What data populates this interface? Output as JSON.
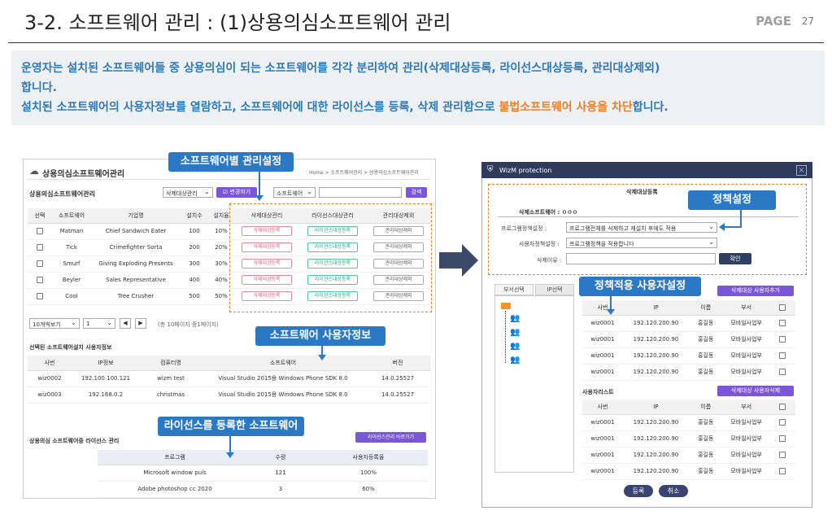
{
  "header": {
    "title": "3-2. 소프트웨어 관리 : (1)상용의심소프트웨어 관리",
    "page_label": "PAGE",
    "page_number": "27"
  },
  "description": {
    "line1": "운영자는 설치된 소프트웨어들 중 상용의심이 되는 소프트웨어를 각각 분리하여 관리(삭제대상등록, 라이선스대상등록, 관리대상제외)",
    "line2": "합니다.",
    "line3_a": "설치된 소프트웨어의 사용자정보를 열람하고, 소프트웨어에 대한 라이선스를 등록, 삭제 관리함으로 ",
    "line3_hl": "불법소프트웨어 사용을 차단",
    "line3_b": "합니다."
  },
  "left_panel": {
    "title": "상용의심소프트웨어관리",
    "breadcrumb": "Home > 소프트웨어관리 > 상용의심소프트웨어관리",
    "list_title": "상용의심소프트웨어관리",
    "filter_select": "삭제대상관리",
    "change_button": "☑ 변경하기",
    "search_select": "소프트웨어",
    "search_button": "검색",
    "columns": [
      "선택",
      "소프트웨어",
      "기업명",
      "설치수",
      "설치율",
      "삭제대상관리",
      "라이선스대상관리",
      "관리대상제외"
    ],
    "rows": [
      {
        "sw": "Matman",
        "company": "Chief Sandwich Eater",
        "count": "100",
        "rate": "10%"
      },
      {
        "sw": "Tick",
        "company": "Crimefighter Sorta",
        "count": "200",
        "rate": "20%"
      },
      {
        "sw": "Smurf",
        "company": "Giving Exploding Presents",
        "count": "300",
        "rate": "30%"
      },
      {
        "sw": "Beyler",
        "company": "Sales Representative",
        "count": "400",
        "rate": "40%"
      },
      {
        "sw": "Cool",
        "company": "Tree Crusher",
        "count": "500",
        "rate": "50%"
      }
    ],
    "tag_delete": "삭제대상등록",
    "tag_license": "라이선스대상등록",
    "tag_exclude": "관리대상제외",
    "page_size": "10개씩보기",
    "page_select": "1",
    "page_info": "(총 10페이지 중1페이지)",
    "user_info_title": "선택된 소프트웨어설치 사용자정보",
    "user_columns": [
      "사번",
      "IP정보",
      "컴퓨터명",
      "소프트웨어",
      "버전"
    ],
    "user_rows": [
      {
        "id": "wiz0002",
        "ip": "192.100.100.121",
        "pc": "wizm test",
        "sw": "Visual Studio 2015용 Windows Phone SDK 8.0",
        "ver": "14.0.25527"
      },
      {
        "id": "wiz0003",
        "ip": "192.168.0.2",
        "pc": "christmas",
        "sw": "Visual Studio 2015용 Windows Phone SDK 8.0",
        "ver": "14.0.25527"
      }
    ],
    "license_title": "상용의심 소프트웨어중 라이선스 관리",
    "license_button": "라이선스관리 바로가기",
    "license_columns": [
      "프로그램",
      "수량",
      "사용자등록율"
    ],
    "license_rows": [
      {
        "program": "Microsoft window puls",
        "qty": "121",
        "rate": "100%"
      },
      {
        "program": "Adobe photoshop cc 2020",
        "qty": "3",
        "rate": "60%"
      }
    ]
  },
  "callouts": {
    "sw_settings": "소프트웨어별 관리설정",
    "sw_user_info": "소프트웨어 사용자정보",
    "license_sw": "라이선스를 등록한 소프트웨어",
    "policy": "정책설정",
    "policy_users": "정책적용 사용자설정"
  },
  "modal": {
    "title": "WizM protection",
    "close": "×",
    "section_title": "삭제대상등록",
    "target_sw": "삭제소프트웨어 : ㅇㅇㅇ",
    "label_program_policy": "프로그램정책설정 :",
    "program_policy_value": "프로그램전체를 삭제하고 재설치 후에도 적용",
    "label_user_policy": "사용자정책설정 :",
    "user_policy_value": "프로그램정책을 적용합니다",
    "label_reason": "삭제이유 :",
    "confirm_button": "확인",
    "tab_dept": "부서선택",
    "tab_ip": "IP선택",
    "add_user_button": "삭제대상 사용자추가",
    "user_columns": [
      "사번",
      "IP",
      "이름",
      "부서"
    ],
    "target_rows": [
      {
        "id": "wiz0001",
        "ip": "192.120.200.90",
        "name": "홍길동",
        "dept": "모바일사업부"
      },
      {
        "id": "wiz0001",
        "ip": "192.120.200.90",
        "name": "홍길동",
        "dept": "모바일사업부"
      },
      {
        "id": "wiz0001",
        "ip": "192.120.200.90",
        "name": "홍길동",
        "dept": "모바일사업부"
      },
      {
        "id": "wiz0001",
        "ip": "192.120.200.90",
        "name": "홍길동",
        "dept": "모바일사업부"
      }
    ],
    "user_list_title": "사용자리스트",
    "delete_user_button": "삭제대상 사용자삭제",
    "list_rows": [
      {
        "id": "wiz0001",
        "ip": "192.120.200.90",
        "name": "홍길동",
        "dept": "모바일사업부"
      },
      {
        "id": "wiz0001",
        "ip": "192.120.200.90",
        "name": "홍길동",
        "dept": "모바일사업부"
      },
      {
        "id": "wiz0001",
        "ip": "192.120.200.90",
        "name": "홍길동",
        "dept": "모바일사업부"
      },
      {
        "id": "wiz0001",
        "ip": "192.120.200.90",
        "name": "홍길동",
        "dept": "모바일사업부"
      }
    ],
    "register_button": "등록",
    "cancel_button": "취소"
  },
  "colors": {
    "accent_blue": "#2b78c5",
    "accent_orange": "#ee7d26",
    "purple": "#7b57d8"
  }
}
